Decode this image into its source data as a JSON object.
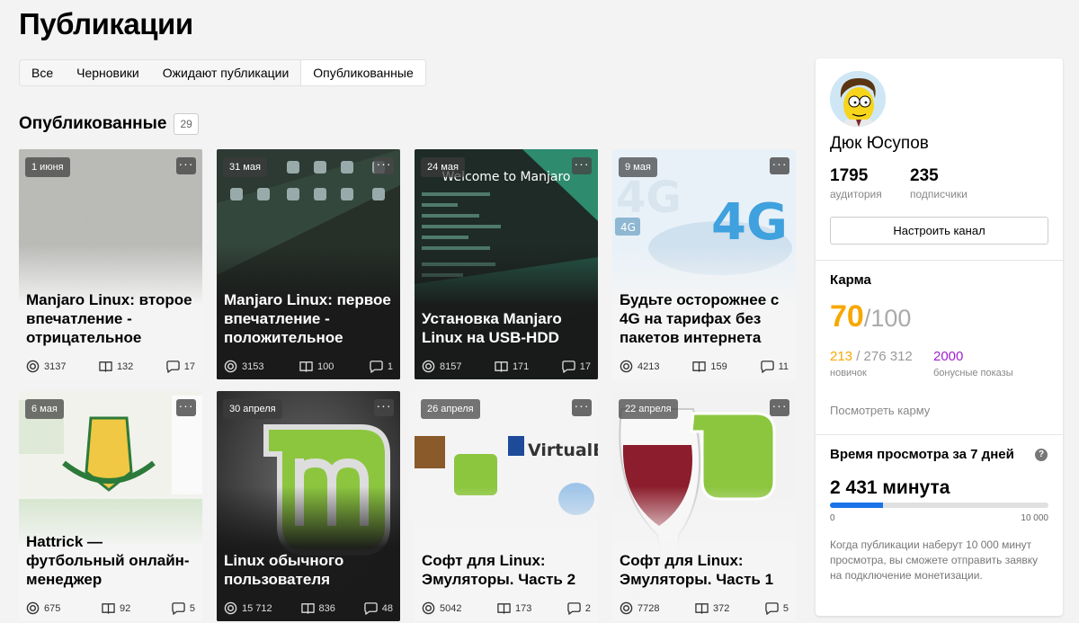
{
  "page_title": "Публикации",
  "tabs": [
    {
      "label": "Все"
    },
    {
      "label": "Черновики"
    },
    {
      "label": "Ожидают публикации"
    },
    {
      "label": "Опубликованные",
      "active": true
    }
  ],
  "section": {
    "title": "Опубликованные",
    "count": "29"
  },
  "cards": [
    {
      "date": "1 июня",
      "title": "Manjaro Linux: второе впечатление - отрицательное",
      "views": "3137",
      "reads": "132",
      "comments": "17",
      "theme": "light",
      "image": "gray-noise"
    },
    {
      "date": "31 мая",
      "title": "Manjaro Linux: первое впечатление - положительное",
      "views": "3153",
      "reads": "100",
      "comments": "1",
      "theme": "dark",
      "image": "manjaro-desktop-icons"
    },
    {
      "date": "24 мая",
      "title": "Установка Manjaro Linux на USB-HDD",
      "views": "8157",
      "reads": "171",
      "comments": "17",
      "theme": "dark",
      "image": "manjaro-welcome",
      "image_text": "Welcome to Manjaro"
    },
    {
      "date": "9 мая",
      "title": "Будьте осторожнее с 4G на тарифах без пакетов интернета",
      "views": "4213",
      "reads": "159",
      "comments": "11",
      "theme": "light",
      "image": "4g-logo",
      "image_text": "4G"
    },
    {
      "date": "6 мая",
      "title": "Hattrick — футбольный онлайн-менеджер",
      "views": "675",
      "reads": "92",
      "comments": "5",
      "theme": "light",
      "image": "hattrick-crest"
    },
    {
      "date": "30 апреля",
      "title": "Linux обычного пользователя",
      "views": "15 712",
      "reads": "836",
      "comments": "48",
      "theme": "dark",
      "image": "linux-mint-logo"
    },
    {
      "date": "26 апреля",
      "title": "Софт для Linux: Эмуляторы. Часть 2",
      "views": "5042",
      "reads": "173",
      "comments": "2",
      "theme": "light",
      "image": "emulators-collage",
      "image_text": "VirtualBo"
    },
    {
      "date": "22 апреля",
      "title": "Софт для Linux: Эмуляторы. Часть 1",
      "views": "7728",
      "reads": "372",
      "comments": "5",
      "theme": "light",
      "image": "wine-and-mint"
    }
  ],
  "more_glyph": "···",
  "icons": {
    "views": "eye-icon",
    "reads": "book-icon",
    "comments": "comment-icon"
  },
  "sidebar": {
    "name": "Дюк Юсупов",
    "audience": {
      "value": "1795",
      "label": "аудитория"
    },
    "subscribers": {
      "value": "235",
      "label": "подписчики"
    },
    "configure_button": "Настроить канал",
    "karma": {
      "title": "Карма",
      "value": "70",
      "max": "/100",
      "rank": "213",
      "rank_total": "/ 276 312",
      "rank_label": "новичок",
      "bonus": "2000",
      "bonus_label": "бонусные показы",
      "link": "Посмотреть карму"
    },
    "watch_time": {
      "title": "Время просмотра за 7 дней",
      "help": "?",
      "value": "2 431 минута",
      "progress": 0.243,
      "min": "0",
      "max": "10 000",
      "note": "Когда публикации наберут 10 000 минут просмотра, вы сможете отправить заявку на подключение монетизации."
    }
  },
  "colors": {
    "karma_value": "#f7a800",
    "rank": "#f7a800",
    "bonus": "#a020d0",
    "progress": "#1a73e8"
  }
}
